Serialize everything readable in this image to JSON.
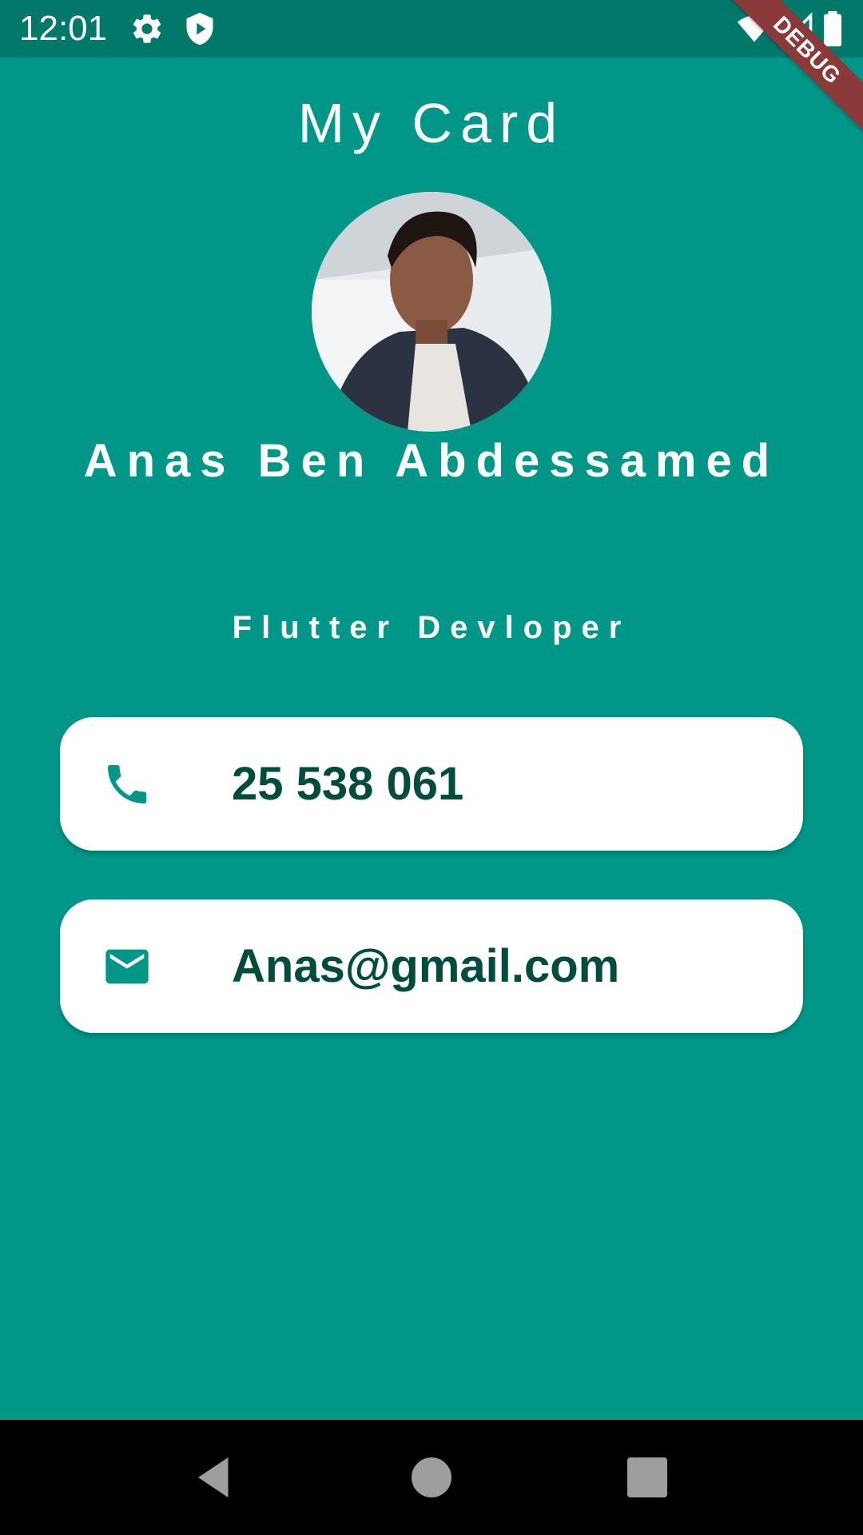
{
  "status_bar": {
    "time": "12:01",
    "icons": [
      "gear-icon",
      "shield-icon",
      "wifi-icon",
      "signal-icon",
      "battery-icon"
    ]
  },
  "debug_banner": {
    "label": "DEBUG"
  },
  "card": {
    "title": "My Card",
    "name": "Anas Ben Abdessamed",
    "job_title": "Flutter Devloper",
    "phone": "25 538 061",
    "email": "Anas@gmail.com"
  },
  "colors": {
    "background": "#009688",
    "status_bar": "#00796b",
    "card_text": "#004d40",
    "icon": "#009688",
    "debug_banner": "#8b3a3a"
  },
  "nav_bar": {
    "buttons": [
      "back-icon",
      "home-icon",
      "recents-icon"
    ]
  }
}
